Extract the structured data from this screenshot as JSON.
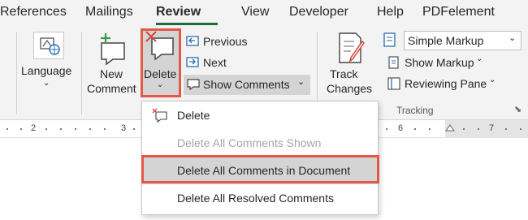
{
  "tabs": [
    "References",
    "Mailings",
    "Review",
    "View",
    "Developer",
    "Help",
    "PDFelement"
  ],
  "active_tab": "Review",
  "ribbon": {
    "language_label": "Language",
    "new_comment_line1": "New",
    "new_comment_line2": "Comment",
    "delete_label": "Delete",
    "previous_label": "Previous",
    "next_label": "Next",
    "show_comments_label": "Show Comments",
    "track_changes_line1": "Track",
    "track_changes_line2": "Changes",
    "markup_select_value": "Simple Markup",
    "show_markup_label": "Show Markup",
    "reviewing_pane_label": "Reviewing Pane",
    "tracking_group_label": "Tracking"
  },
  "ruler": [
    "2",
    "3",
    "6",
    "7"
  ],
  "menu": {
    "items": [
      {
        "label": "Delete",
        "enabled": true
      },
      {
        "label": "Delete All Comments Shown",
        "enabled": false
      },
      {
        "label": "Delete All Comments in Document",
        "enabled": true,
        "highlighted": true
      },
      {
        "label": "Delete All Resolved Comments",
        "enabled": true
      }
    ]
  },
  "colors": {
    "accent_green": "#1e6b3c",
    "highlight_red": "#e05a4a",
    "icon_blue": "#2b6cb0",
    "icon_green": "#3c9b4a"
  }
}
